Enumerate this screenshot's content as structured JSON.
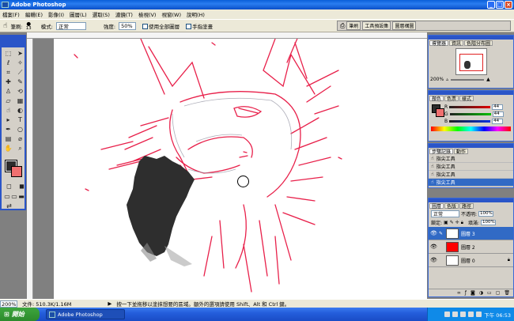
{
  "window": {
    "title": "Adobe Photoshop"
  },
  "menu": [
    "檔案(F)",
    "編輯(E)",
    "影像(I)",
    "圖層(L)",
    "選取(S)",
    "濾鏡(T)",
    "檢視(V)",
    "視窗(W)",
    "說明(H)"
  ],
  "options": {
    "brush_label": "筆刷:",
    "brush_size": "13",
    "mode_label": "模式:",
    "mode_value": "正常",
    "strength_label": "強度:",
    "strength_value": "50%",
    "all_layers_label": "使用全部圖層",
    "finger_paint_label": "手指塗畫"
  },
  "palette_well": [
    "筆刷",
    "工具預設集",
    "圖層構圖"
  ],
  "navigator": {
    "tabs": [
      "導覽器",
      "資訊",
      "色階分布圖"
    ],
    "zoom": "200%"
  },
  "color_panel": {
    "tabs": [
      "顏色",
      "色票",
      "樣式"
    ],
    "channels": [
      {
        "label": "R",
        "value": "44",
        "color": "#cc2020"
      },
      {
        "label": "G",
        "value": "44",
        "color": "#20a020"
      },
      {
        "label": "B",
        "value": "44",
        "color": "#2040c0"
      }
    ]
  },
  "history": {
    "tabs": [
      "步驟記錄",
      "動作"
    ],
    "items": [
      "指尖工具",
      "指尖工具",
      "指尖工具",
      "指尖工具"
    ]
  },
  "layers": {
    "tabs": [
      "圖層",
      "色版",
      "路徑"
    ],
    "blend_mode": "正常",
    "opacity_label": "不透明:",
    "opacity_value": "100%",
    "lock_label": "鎖定:",
    "fill_label": "填滿:",
    "fill_value": "100%",
    "items": [
      {
        "name": "圖層 3",
        "selected": true,
        "thumb_color": "#ffffff"
      },
      {
        "name": "圖層 2",
        "selected": false,
        "thumb_color": "#ff0000"
      },
      {
        "name": "圖層 0",
        "selected": false,
        "thumb_color": "#ffffff"
      }
    ]
  },
  "status": {
    "zoom": "200%",
    "doc_info": "文件: 510.3K/1.16M",
    "hint": "按一下並拖移以塗抹想要的區域。額外的選項請使用 Shift、Alt 和 Ctrl 鍵。"
  },
  "taskbar": {
    "start_label": "開始",
    "task_label": "Adobe Photoshop",
    "clock": "下午 06:53"
  }
}
